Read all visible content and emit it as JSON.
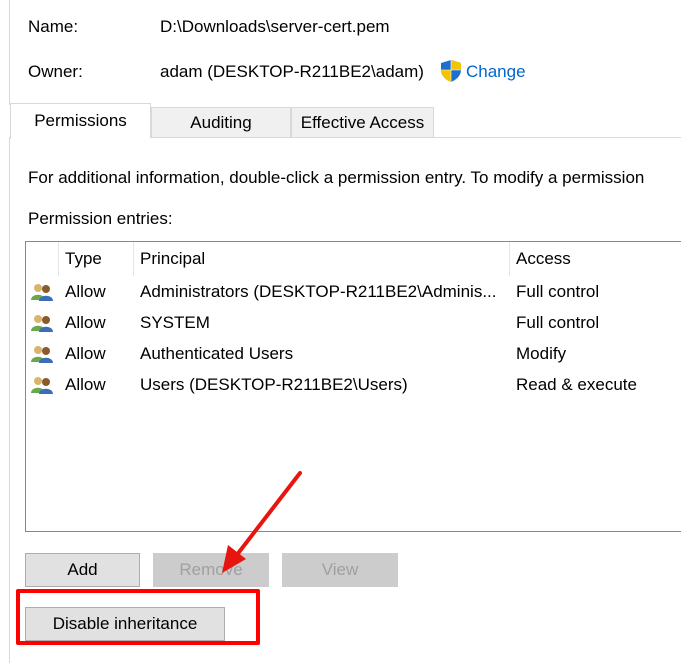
{
  "file": {
    "name_label": "Name:",
    "name_value": "D:\\Downloads\\server-cert.pem",
    "owner_label": "Owner:",
    "owner_value": "adam (DESKTOP-R211BE2\\adam)",
    "change_link": "Change"
  },
  "tabs": [
    {
      "label": "Permissions",
      "active": true
    },
    {
      "label": "Auditing",
      "active": false
    },
    {
      "label": "Effective Access",
      "active": false
    }
  ],
  "info_text": "For additional information, double-click a permission entry. To modify a permission",
  "entries_label": "Permission entries:",
  "table": {
    "columns": [
      "Type",
      "Principal",
      "Access"
    ],
    "rows": [
      {
        "type": "Allow",
        "principal": "Administrators (DESKTOP-R211BE2\\Adminis...",
        "access": "Full control"
      },
      {
        "type": "Allow",
        "principal": "SYSTEM",
        "access": "Full control"
      },
      {
        "type": "Allow",
        "principal": "Authenticated Users",
        "access": "Modify"
      },
      {
        "type": "Allow",
        "principal": "Users (DESKTOP-R211BE2\\Users)",
        "access": "Read & execute"
      }
    ]
  },
  "buttons": {
    "add": "Add",
    "remove": "Remove",
    "view": "View",
    "disable_inheritance": "Disable inheritance"
  },
  "colors": {
    "link": "#0066cc",
    "annotation": "#ff0000",
    "disabled_text": "#a0a0a0"
  },
  "icons": {
    "shield": "uac-shield-icon",
    "user": "users-group-icon"
  }
}
